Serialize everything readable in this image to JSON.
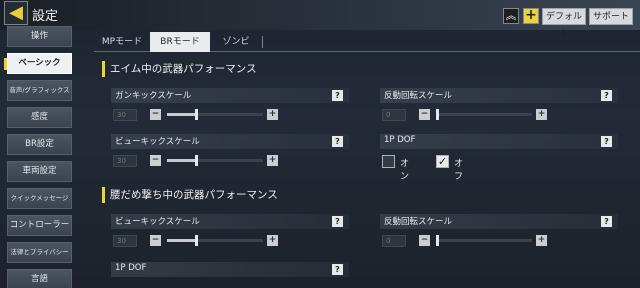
{
  "header": {
    "title": "設定",
    "default_label": "デフォルト",
    "support_label": "サポート"
  },
  "icons": {
    "back": "back-arrow-icon",
    "collapse": "double-chevron-up-icon",
    "add": "plus-icon"
  },
  "colors": {
    "accent": "#e9d53a",
    "active_bg": "#eef1f2"
  },
  "sidebar": {
    "items": [
      {
        "label": "操作"
      },
      {
        "label": "ベーシック"
      },
      {
        "label": "音声/グラフィックス"
      },
      {
        "label": "感度"
      },
      {
        "label": "BR設定"
      },
      {
        "label": "車両設定"
      },
      {
        "label": "クイックメッセージ"
      },
      {
        "label": "コントローラー"
      },
      {
        "label": "法律とプライバシー"
      },
      {
        "label": "言語"
      }
    ],
    "active_index": 1
  },
  "tabs": [
    {
      "label": "MPモード"
    },
    {
      "label": "BRモード"
    },
    {
      "label": "ゾンビ"
    }
  ],
  "active_tab": 1,
  "sections": [
    {
      "title": "エイム中の武器パフォーマンス",
      "settings": [
        {
          "label": "ガンキックスケール",
          "value": "30",
          "level": 0.3
        },
        {
          "label": "反動回転スケール",
          "value": "0",
          "level": 0.0
        },
        {
          "label": "ビューキックスケール",
          "value": "30",
          "level": 0.3
        },
        {
          "label": "1P DOF",
          "option_off": "オン",
          "option_on": "オフ",
          "selected": "オフ"
        }
      ]
    },
    {
      "title": "腰だめ撃ち中の武器パフォーマンス",
      "settings": [
        {
          "label": "ビューキックスケール",
          "value": "30",
          "level": 0.3
        },
        {
          "label": "反動回転スケール",
          "value": "0",
          "level": 0.0
        },
        {
          "label": "1P DOF"
        }
      ]
    }
  ],
  "help_glyph": "?",
  "minus_glyph": "−",
  "plus_glyph": "+",
  "check_glyph": "✓"
}
